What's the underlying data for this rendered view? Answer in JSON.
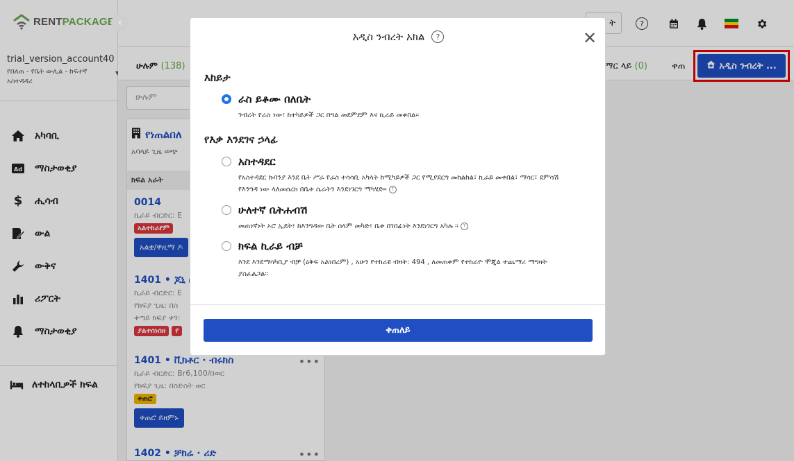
{
  "brand": {
    "rent": "RENT",
    "package": "PACKAGE"
  },
  "account": {
    "name": "trial_version_account40",
    "role": "የበለጠ - የቤት ውሊል - ከፍተኛ አስተዳዳሪ"
  },
  "nav": {
    "items": [
      {
        "label": "አካባቢ",
        "icon": "home-icon"
      },
      {
        "label": "ማስታወቂያ",
        "icon": "ad-icon"
      },
      {
        "label": "ሒሳብ",
        "icon": "dollar-icon"
      },
      {
        "label": "ውል",
        "icon": "contract-icon"
      },
      {
        "label": "ውቅና",
        "icon": "wrench-icon"
      },
      {
        "label": "ሪፖርት",
        "icon": "bar-chart-icon"
      },
      {
        "label": "ማስታወቂያ",
        "icon": "bell-icon"
      }
    ],
    "bottom": "ለተከላቢዎች ክፍል"
  },
  "topbar": {
    "button_label": "ት"
  },
  "tabs": {
    "all_label": "ሁሉም",
    "all_count": "(138)",
    "occupied_label": "ማር ላይ",
    "occupied_count": "(0)",
    "next_label": "ቀጠ"
  },
  "add_button": "አዲስ ንብረት ...",
  "list": {
    "search_placeholder": "ሁሉም",
    "property_title": "የነጠልበለ",
    "property_sub": "አባላይ ጊዜ ወጭ",
    "section_label": "ክፍል አራት",
    "units": [
      {
        "no": "0014",
        "line1": "ኪራይ ብርድር: E",
        "badge": "አልተከራየም",
        "button": "አልቋ/ዋዚማ ዶ"
      },
      {
        "no": "1401 • ጆኒ ሮ",
        "line1": "ኪራይ ብርድር: E",
        "line2": "የክፍያ ጊዜ: በስ",
        "line3": "ቀጣይ ክፍያ ቀን:",
        "badge": "ያልተሰነሰዘ",
        "badge2": "የ"
      },
      {
        "no": "1401 • ቪክቶር · ብሩክስ",
        "line1": "ኪራይ ብርድር: Br6,100/በወር",
        "line2": "የክፍያ ጊዜ: በስድስት ወር",
        "badge": "ቀጠሮ",
        "button": "ቀጠሮ ይዘምኑ"
      },
      {
        "no": "1402 • ቻክሬ · ሪድ"
      }
    ]
  },
  "modal": {
    "title": "አዲስ ንብረት አክል",
    "group1": "እከይታ",
    "group2": "የእቃ እንደገና ኃላፊ",
    "options": [
      {
        "label": "ራስ ይቆሙ በለቤት",
        "desc": "ንብረት የራስ ነው፣ ከተካይዎች ጋር በግል መደምደም እና ኪራይ መቀበል።",
        "checked": true
      },
      {
        "label": "አስተዳደር",
        "desc": "የአስተዳደር ኩባንያ እንደ ቤት ሥራ የራስ ተሳሳቢ አካላት ከሚካይዎች ጋር የሚያደርግ መከልከል፣ ኪራይ መቀበል፣ ማሳር፣ ደምሳሽ የእንግዳ ነው ላለመሰረክ በቤቱ ሴራትን እንደነገርግ ማካሄድ።"
      },
      {
        "label": "ሁለተኛ ቤትሐብሽ",
        "desc": "መጠነኛነት ኦሮ ኢደት፣ ከእንግዳው ቤት ሰላም መካድ፣ ቤቱ በገበፊነት እንደነገርግ አካሉ ።"
      },
      {
        "label": "ክፍል ኪራይ ብቻ",
        "desc": "እንደ እንደማሳካቢያ ብቻ (ዕቅፍ አልነበረም) , አሁን የተከራዩ ብዛት: 494 , ለመጠቀም የተከራዮ ሞጂል ተጨማሪ ማግዛት ያስፈልጋል።"
      }
    ],
    "continue": "ቀጠለይ"
  }
}
